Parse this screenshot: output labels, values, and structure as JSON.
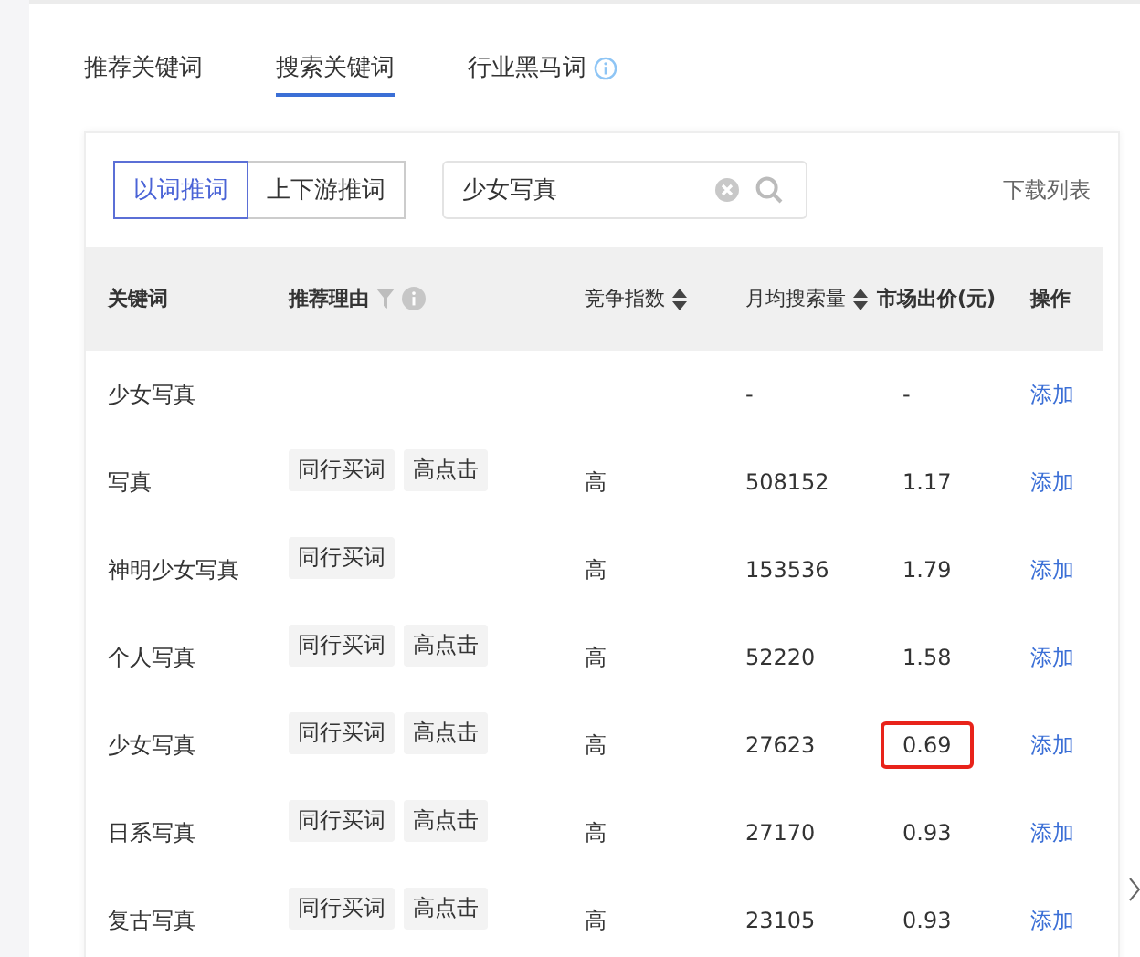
{
  "tabs": [
    {
      "label": "推荐关键词",
      "selected": false,
      "info": false
    },
    {
      "label": "搜索关键词",
      "selected": true,
      "info": false
    },
    {
      "label": "行业黑马词",
      "selected": false,
      "info": true
    }
  ],
  "mode_buttons": [
    {
      "label": "以词推词",
      "selected": true
    },
    {
      "label": "上下游推词",
      "selected": false
    }
  ],
  "search": {
    "value": "少女写真"
  },
  "download_link": "下载列表",
  "table": {
    "columns": [
      {
        "label": "关键词",
        "kind": "plain"
      },
      {
        "label": "推荐理由",
        "kind": "filter"
      },
      {
        "label": "竞争指数",
        "kind": "sort"
      },
      {
        "label": "月均搜索量",
        "kind": "sort"
      },
      {
        "label": "市场出价(元)",
        "kind": "plain"
      },
      {
        "label": "操作",
        "kind": "plain"
      }
    ],
    "rows": [
      {
        "keyword": "少女写真",
        "reasons": [],
        "competition": "",
        "volume": "-",
        "price": "-",
        "highlighted": false,
        "action": "添加"
      },
      {
        "keyword": "写真",
        "reasons": [
          "同行买词",
          "高点击"
        ],
        "competition": "高",
        "volume": "508152",
        "price": "1.17",
        "highlighted": false,
        "action": "添加"
      },
      {
        "keyword": "神明少女写真",
        "reasons": [
          "同行买词"
        ],
        "competition": "高",
        "volume": "153536",
        "price": "1.79",
        "highlighted": false,
        "action": "添加"
      },
      {
        "keyword": "个人写真",
        "reasons": [
          "同行买词",
          "高点击"
        ],
        "competition": "高",
        "volume": "52220",
        "price": "1.58",
        "highlighted": false,
        "action": "添加"
      },
      {
        "keyword": "少女写真",
        "reasons": [
          "同行买词",
          "高点击"
        ],
        "competition": "高",
        "volume": "27623",
        "price": "0.69",
        "highlighted": true,
        "action": "添加"
      },
      {
        "keyword": "日系写真",
        "reasons": [
          "同行买词",
          "高点击"
        ],
        "competition": "高",
        "volume": "27170",
        "price": "0.93",
        "highlighted": false,
        "action": "添加"
      },
      {
        "keyword": "复古写真",
        "reasons": [
          "同行买词",
          "高点击"
        ],
        "competition": "高",
        "volume": "23105",
        "price": "0.93",
        "highlighted": false,
        "action": "添加"
      }
    ]
  }
}
